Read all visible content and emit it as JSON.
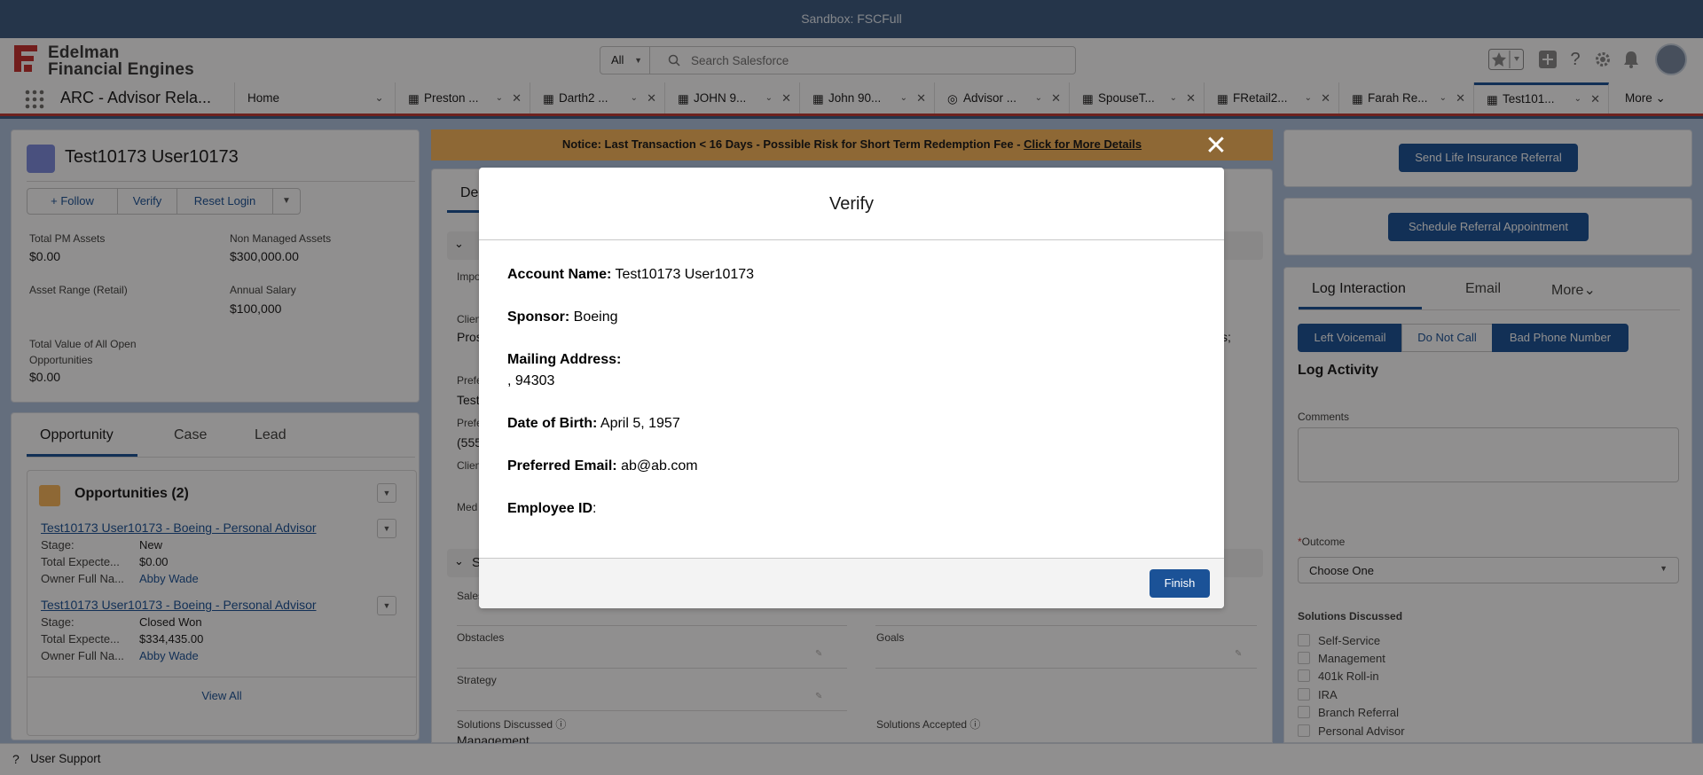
{
  "sandbox_label": "Sandbox: FSCFull",
  "header": {
    "logo_line1": "Edelman",
    "logo_line2": "Financial Engines",
    "search_scope": "All",
    "search_placeholder": "Search Salesforce"
  },
  "nav": {
    "app_name": "ARC - Advisor Rela...",
    "home": "Home",
    "tabs": [
      {
        "label": "Preston ..."
      },
      {
        "label": "Darth2 ..."
      },
      {
        "label": "JOHN 9..."
      },
      {
        "label": "John 90..."
      },
      {
        "label": "Advisor ..."
      },
      {
        "label": "SpouseT..."
      },
      {
        "label": "FRetail2..."
      },
      {
        "label": "Farah Re..."
      },
      {
        "label": "Test101..."
      }
    ],
    "more": "More"
  },
  "account": {
    "name": "Test10173 User10173",
    "follow": "Follow",
    "verify": "Verify",
    "reset_login": "Reset Login",
    "fields": [
      {
        "label": "Total PM Assets",
        "value": "$0.00"
      },
      {
        "label": "Non Managed Assets",
        "value": "$300,000.00"
      },
      {
        "label": "Asset Range (Retail)",
        "value": ""
      },
      {
        "label": "Annual Salary",
        "value": "$100,000"
      },
      {
        "label": "Total Value of All Open Opportunities",
        "value": "$0.00"
      }
    ]
  },
  "related": {
    "tabs": [
      "Opportunity",
      "Case",
      "Lead"
    ],
    "opps_title": "Opportunities (2)",
    "opps": [
      {
        "name": "Test10173 User10173 - Boeing - Personal Advisor",
        "stage_label": "Stage:",
        "stage": "New",
        "exp_label": "Total Expecte...",
        "exp": "$0.00",
        "owner_label": "Owner Full Na...",
        "owner": "Abby Wade"
      },
      {
        "name": "Test10173 User10173 - Boeing - Personal Advisor",
        "stage_label": "Stage:",
        "stage": "Closed Won",
        "exp_label": "Total Expecte...",
        "exp": "$334,435.00",
        "owner_label": "Owner Full Na...",
        "owner": "Abby Wade"
      }
    ],
    "view_all": "View All"
  },
  "notice": {
    "text": "Notice: Last Transaction < 16 Days - Possible Risk for Short Term Redemption Fee - ",
    "link": "Click for More Details"
  },
  "center": {
    "tab_partial": "De",
    "labels_partial": [
      "Impo",
      "Clien",
      "Pros",
      "Prefe",
      "Test",
      "Prefe",
      "(555",
      "Clien",
      "Med"
    ],
    "section_partial": "S",
    "right_partial": "s;",
    "sales_partial": "Sales",
    "obstacles": "Obstacles",
    "goals": "Goals",
    "strategy": "Strategy",
    "solutions_discussed": "Solutions Discussed",
    "solutions_accepted": "Solutions Accepted",
    "sol_value_partial": "Management"
  },
  "right": {
    "send_referral": "Send Life Insurance Referral",
    "schedule_referral": "Schedule Referral Appointment",
    "tabs": [
      "Log Interaction",
      "Email",
      "More"
    ],
    "quick_buttons": [
      "Left Voicemail",
      "Do Not Call",
      "Bad Phone Number"
    ],
    "log_activity": "Log Activity",
    "comments_label": "Comments",
    "outcome_label": "Outcome",
    "outcome_value": "Choose One",
    "solutions_label": "Solutions Discussed",
    "solutions": [
      "Self-Service",
      "Management",
      "401k Roll-in",
      "IRA",
      "Branch Referral",
      "Personal Advisor"
    ]
  },
  "modal": {
    "title": "Verify",
    "account_label": "Account Name:",
    "account_value": "Test10173 User10173",
    "sponsor_label": "Sponsor:",
    "sponsor_value": "Boeing",
    "mailing_label": "Mailing Address:",
    "mailing_value": ", 94303",
    "dob_label": "Date of Birth:",
    "dob_value": "April 5, 1957",
    "email_label": "Preferred Email:",
    "email_value": "ab@ab.com",
    "employee_label": "Employee ID",
    "employee_colon": ":",
    "finish": "Finish"
  },
  "utility": {
    "user_support": "User Support"
  },
  "colors": {
    "brand": "#1b5297",
    "logo_red": "#c8312f",
    "notice_bg": "#fcb95b",
    "sandbox_bg": "#3c5b82"
  }
}
